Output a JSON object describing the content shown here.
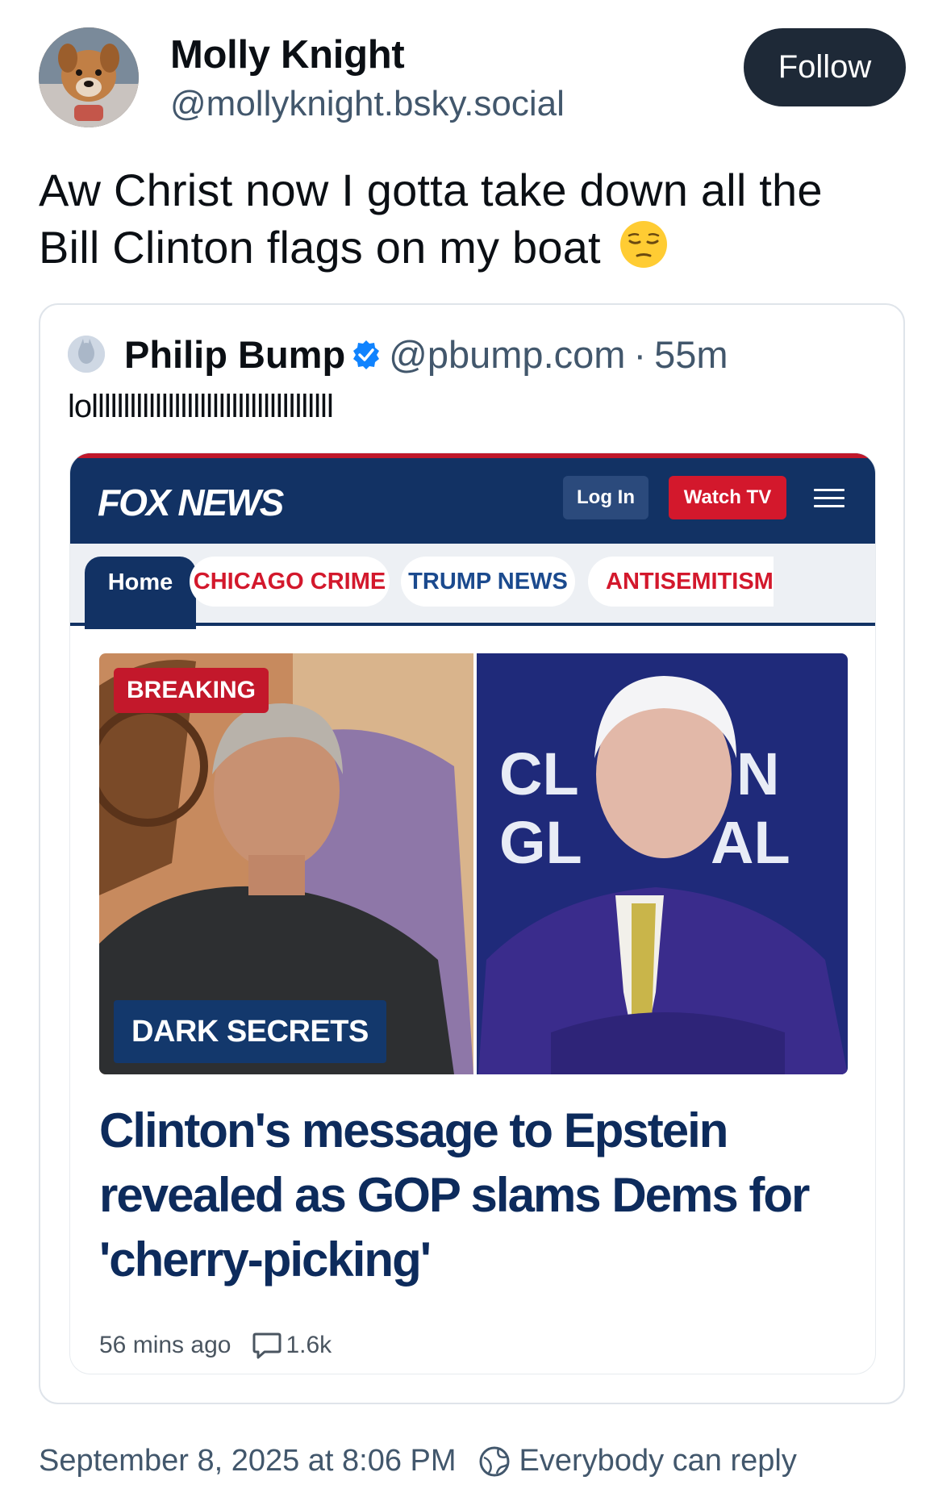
{
  "post": {
    "author_name": "Molly Knight",
    "author_handle": "@mollyknight.bsky.social",
    "follow_label": "Follow",
    "text": "Aw Christ now I gotta take down all the Bill Clinton flags on my boat",
    "emoji": "pensive-face",
    "timestamp": "September 8, 2025 at 8:06 PM",
    "reply_setting": "Everybody can reply"
  },
  "quote": {
    "author_name": "Philip Bump",
    "author_handle": "@pbump.com",
    "separator": "·",
    "time": "55m",
    "text": "lollllllllllllllllllllllllllllllllllllll",
    "verified": true
  },
  "screenshot": {
    "site_logo": "FOX NEWS",
    "login_label": "Log In",
    "watch_label": "Watch TV",
    "tabs": [
      {
        "label": "Home",
        "active": true
      },
      {
        "label": "CHICAGO CRIME",
        "active": false
      },
      {
        "label": "TRUMP NEWS",
        "active": false
      },
      {
        "label": "ANTISEMITISM",
        "active": false
      }
    ],
    "badge_breaking": "BREAKING",
    "badge_dark": "DARK SECRETS",
    "backdrop_text_1": "CL",
    "backdrop_text_2": "N",
    "backdrop_text_3": "GL",
    "backdrop_text_4": "AL",
    "headline": "Clinton's message to Epstein revealed as GOP slams Dems for 'cherry-picking'",
    "time_ago": "56 mins ago",
    "comment_count": "1.6k"
  },
  "colors": {
    "follow_bg": "#1e2937",
    "fox_navy": "#123264",
    "fox_red": "#d3182c",
    "verified_blue": "#1083fe",
    "muted": "#42576c"
  }
}
